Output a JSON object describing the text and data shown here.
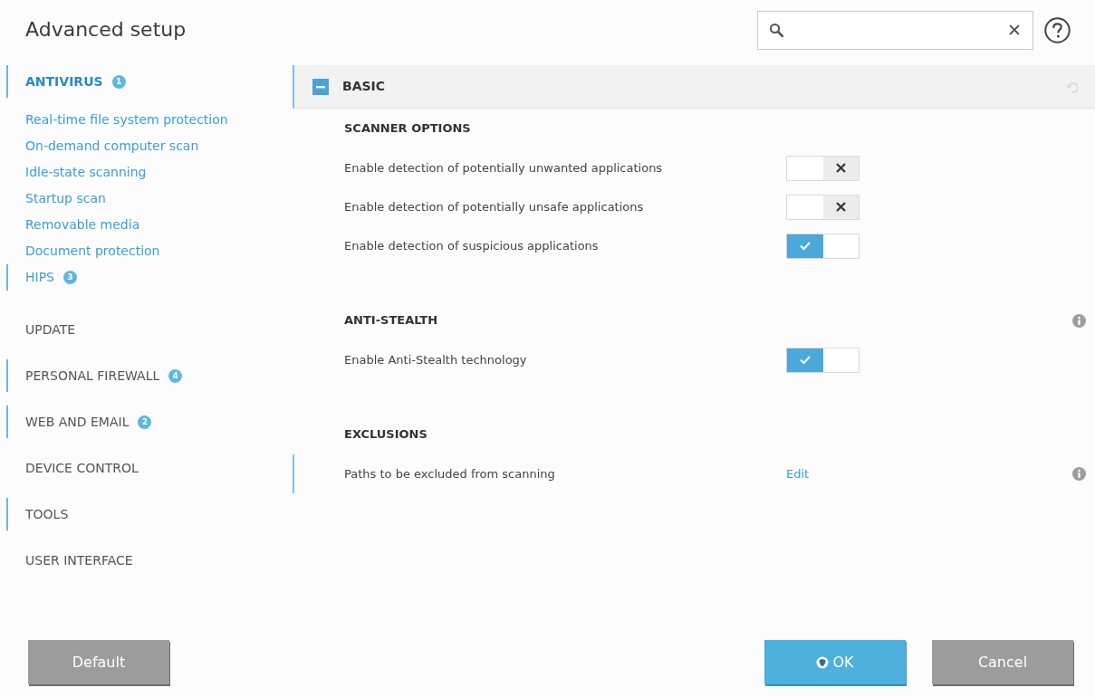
{
  "window": {
    "title": "Advanced setup"
  },
  "sidebar": {
    "items": [
      {
        "label": "ANTIVIRUS",
        "selected": true,
        "modified": true,
        "badge": "1",
        "children": [
          {
            "label": "Real-time file system protection",
            "selected": false,
            "modified": false
          },
          {
            "label": "On-demand computer scan",
            "selected": false,
            "modified": false
          },
          {
            "label": "Idle-state scanning",
            "selected": false,
            "modified": false
          },
          {
            "label": "Startup scan",
            "selected": false,
            "modified": false
          },
          {
            "label": "Removable media",
            "selected": false,
            "modified": false
          },
          {
            "label": "Document protection",
            "selected": false,
            "modified": false
          },
          {
            "label": "HIPS",
            "selected": false,
            "modified": true,
            "badge": "3"
          }
        ]
      },
      {
        "label": "UPDATE",
        "selected": false,
        "modified": false
      },
      {
        "label": "PERSONAL FIREWALL",
        "selected": false,
        "modified": true,
        "badge": "4"
      },
      {
        "label": "WEB AND EMAIL",
        "selected": false,
        "modified": true,
        "badge": "2"
      },
      {
        "label": "DEVICE CONTROL",
        "selected": false,
        "modified": false
      },
      {
        "label": "TOOLS",
        "selected": false,
        "modified": true
      },
      {
        "label": "USER INTERFACE",
        "selected": false,
        "modified": false
      }
    ]
  },
  "panel": {
    "title": "BASIC",
    "expanded": true,
    "modified": true,
    "revert_disabled": true,
    "groups": [
      {
        "title": "SCANNER OPTIONS",
        "info": false,
        "rows": [
          {
            "kind": "toggle",
            "label": "Enable detection of potentially unwanted applications",
            "on": false,
            "modified": false,
            "info": false
          },
          {
            "kind": "toggle",
            "label": "Enable detection of potentially unsafe applications",
            "on": false,
            "modified": false,
            "info": false
          },
          {
            "kind": "toggle",
            "label": "Enable detection of suspicious applications",
            "on": true,
            "modified": false,
            "info": false
          }
        ]
      },
      {
        "title": "ANTI-STEALTH",
        "info": true,
        "rows": [
          {
            "kind": "toggle",
            "label": "Enable Anti-Stealth technology",
            "on": true,
            "modified": false,
            "info": false
          }
        ]
      },
      {
        "title": "EXCLUSIONS",
        "info": false,
        "rows": [
          {
            "kind": "link",
            "label": "Paths to be excluded from scanning",
            "link": "Edit",
            "modified": true,
            "info": true
          }
        ]
      }
    ]
  },
  "footer": {
    "left": [
      {
        "label": "Default",
        "kind": "secondary"
      }
    ],
    "right": [
      {
        "label": "OK",
        "kind": "primary"
      },
      {
        "label": "Cancel",
        "kind": "secondary"
      }
    ]
  }
}
